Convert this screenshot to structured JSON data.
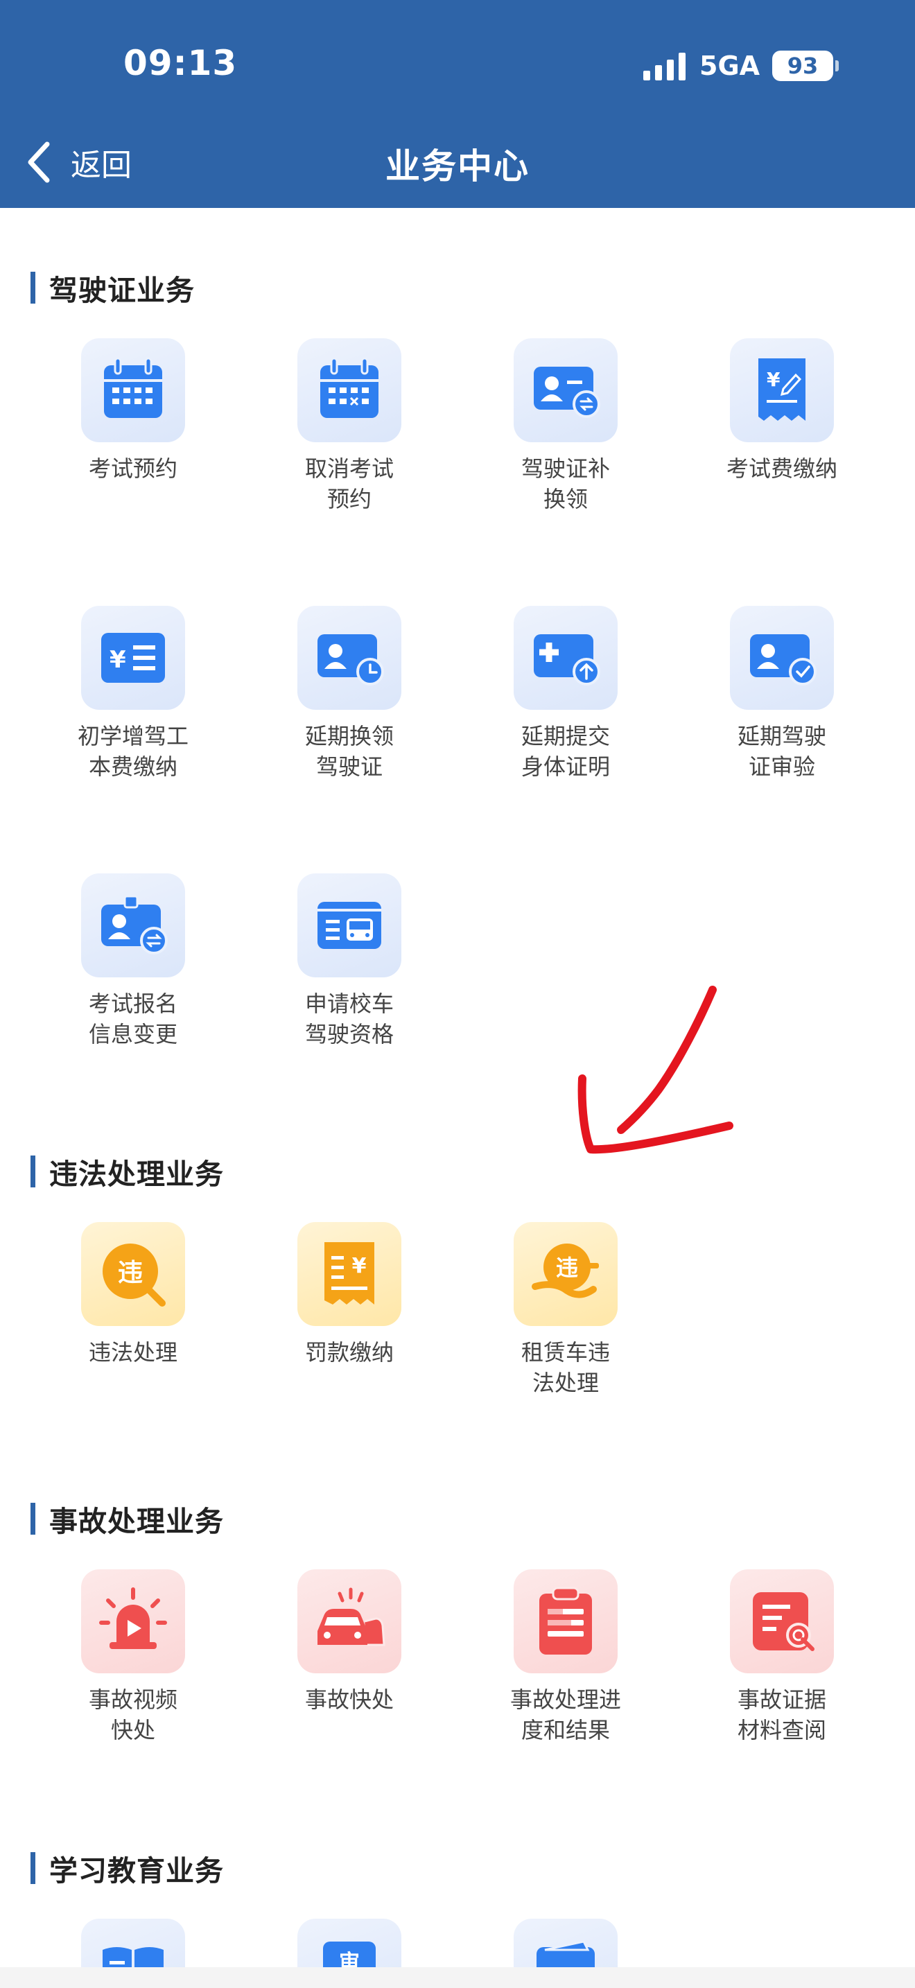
{
  "status_bar": {
    "time": "09:13",
    "network": "5GA",
    "battery": "93"
  },
  "nav": {
    "back_label": "返回",
    "title": "业务中心"
  },
  "sections": [
    {
      "title": "驾驶证业务",
      "items": [
        {
          "label": "考试预约",
          "icon": "calendar-icon"
        },
        {
          "label": "取消考试\n预约",
          "icon": "calendar-cancel-icon"
        },
        {
          "label": "驾驶证补\n换领",
          "icon": "id-card-exchange-icon"
        },
        {
          "label": "考试费缴纳",
          "icon": "fee-receipt-icon"
        },
        {
          "label": "初学增驾工\n本费缴纳",
          "icon": "yuan-list-icon"
        },
        {
          "label": "延期换领\n驾驶证",
          "icon": "id-card-clock-icon"
        },
        {
          "label": "延期提交\n身体证明",
          "icon": "medical-upload-icon"
        },
        {
          "label": "延期驾驶\n证审验",
          "icon": "id-card-check-icon"
        },
        {
          "label": "考试报名\n信息变更",
          "icon": "badge-exchange-icon"
        },
        {
          "label": "申请校车\n驾驶资格",
          "icon": "school-bus-card-icon"
        }
      ]
    },
    {
      "title": "违法处理业务",
      "items": [
        {
          "label": "违法处理",
          "icon": "violation-search-icon"
        },
        {
          "label": "罚款缴纳",
          "icon": "fine-receipt-icon"
        },
        {
          "label": "租赁车违\n法处理",
          "icon": "rental-violation-icon"
        }
      ]
    },
    {
      "title": "事故处理业务",
      "items": [
        {
          "label": "事故视频\n快处",
          "icon": "alarm-video-icon"
        },
        {
          "label": "事故快处",
          "icon": "car-crash-icon"
        },
        {
          "label": "事故处理进\n度和结果",
          "icon": "clipboard-progress-icon"
        },
        {
          "label": "事故证据\n材料查阅",
          "icon": "document-search-icon"
        }
      ]
    },
    {
      "title": "学习教育业务",
      "items": [
        {
          "label": "",
          "icon": "book-icon"
        },
        {
          "label": "",
          "icon": "review-badge-icon"
        },
        {
          "label": "",
          "icon": "calendar-day-icon"
        }
      ]
    }
  ],
  "colors": {
    "header": "#2e64a8",
    "icon_blue": "#2f7ff0",
    "icon_orange": "#f5a317",
    "icon_red": "#ef4f4f",
    "annotation_red": "#e4151f"
  }
}
